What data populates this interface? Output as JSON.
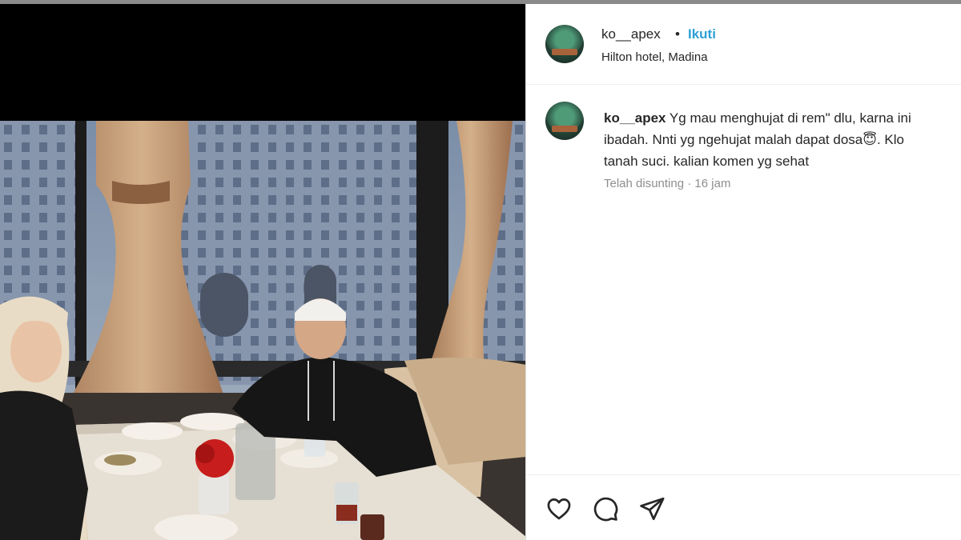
{
  "post": {
    "username": "ko__apex",
    "separator": "•",
    "follow_label": "Ikuti",
    "location": "Hilton hotel, Madina"
  },
  "caption": {
    "username": "ko__apex",
    "line1": "Yg mau menghujat di rem\" dlu, karna ini",
    "line2": "ibadah. Nnti yg ngehujat malah dapat dosa😇. Klo",
    "line3": "tanah suci. kalian komen yg sehat",
    "edited_label": "Telah disunting",
    "time_separator": "·",
    "time": "16 jam"
  },
  "icons": {
    "like": "heart-icon",
    "comment": "comment-icon",
    "share": "send-icon"
  },
  "colors": {
    "follow": "#2f9fd6",
    "meta": "#8e8e8e"
  }
}
